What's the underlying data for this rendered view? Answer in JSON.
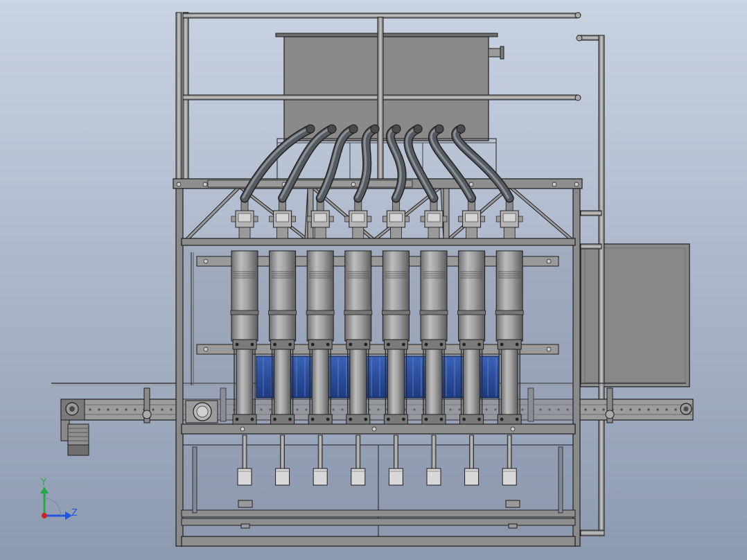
{
  "view": {
    "background_top": "#c9d3e2",
    "background_bottom": "#8c9ab0"
  },
  "colors": {
    "steel": "#8a8a8a",
    "steel_dark": "#5a5a5a",
    "steel_light": "#b4b4b4",
    "outline": "#1e1e1e",
    "hose": "#555a60",
    "bottles": "#2c4f9e"
  },
  "machine": {
    "filling_heads": 8
  },
  "triad": {
    "y_label": "Y",
    "z_label": "Z",
    "y_color": "#22a844",
    "z_color": "#2255dd",
    "origin_color": "#cc2222"
  }
}
